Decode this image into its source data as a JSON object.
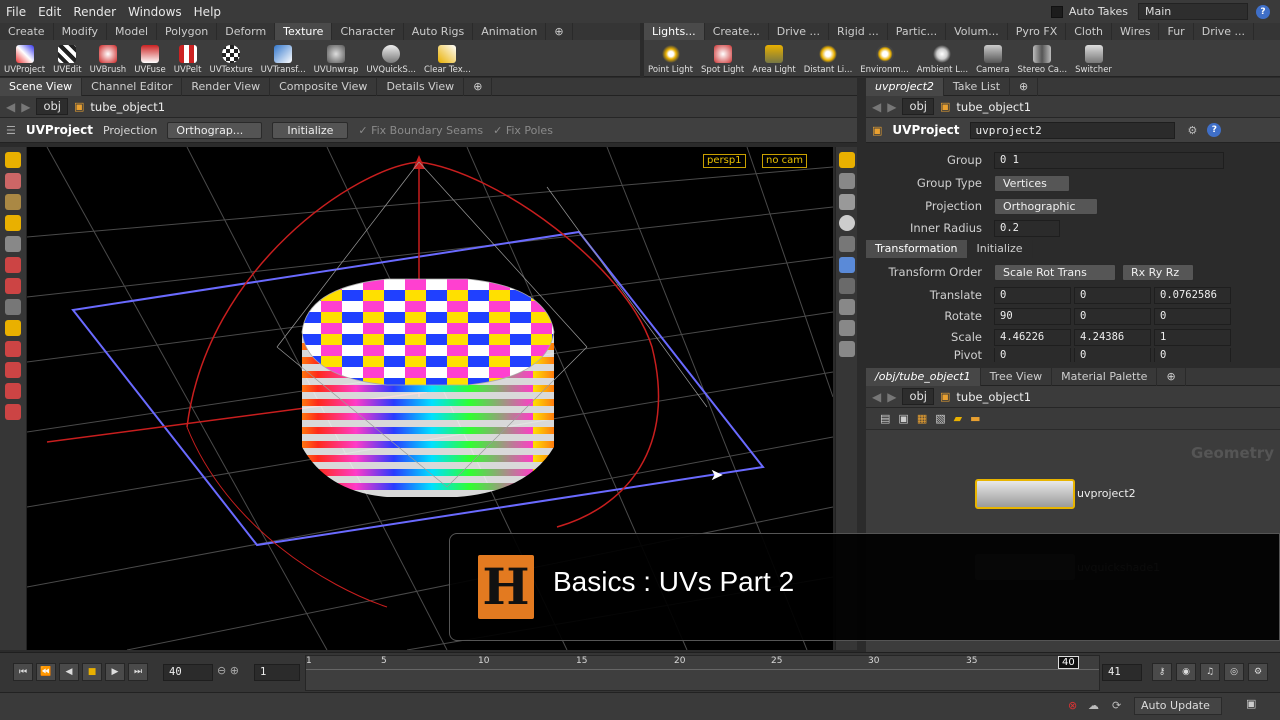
{
  "menubar": {
    "items": [
      "File",
      "Edit",
      "Render",
      "Windows",
      "Help"
    ],
    "auto_takes_label": "Auto Takes",
    "desktop_value": "Main"
  },
  "shelf_left": {
    "tabs": [
      "Create",
      "Modify",
      "Model",
      "Polygon",
      "Deform",
      "Texture",
      "Character",
      "Auto Rigs",
      "Animation"
    ],
    "active_tab": "Texture",
    "tools": [
      "UVProject",
      "UVEdit",
      "UVBrush",
      "UVFuse",
      "UVPelt",
      "UVTexture",
      "UVTransf...",
      "UVUnwrap",
      "UVQuickS...",
      "Clear Tex..."
    ]
  },
  "shelf_right": {
    "tabs": [
      "Lights...",
      "Create...",
      "Drive ...",
      "Rigid ...",
      "Partic...",
      "Volum...",
      "Pyro FX",
      "Cloth",
      "Wires",
      "Fur",
      "Drive ..."
    ],
    "active_tab": "Lights...",
    "tools": [
      "Point Light",
      "Spot Light",
      "Area Light",
      "Distant Li...",
      "Environm...",
      "Ambient L...",
      "Camera",
      "Stereo Ca...",
      "Switcher"
    ]
  },
  "viewer": {
    "tabs": [
      "Scene View",
      "Channel Editor",
      "Render View",
      "Composite View",
      "Details View"
    ],
    "active_tab": "Scene View",
    "path_root": "obj",
    "path_node": "tube_object1",
    "tool_title": "UVProject",
    "projection_label": "Projection",
    "projection_value": "Orthograp...",
    "initialize_label": "Initialize",
    "fix_seams_label": "Fix Boundary Seams",
    "fix_poles_label": "Fix Poles",
    "camera_label": "persp1",
    "cam_label": "no cam"
  },
  "params_panel": {
    "tabs": [
      "uvproject2",
      "Take List"
    ],
    "path_root": "obj",
    "path_node": "tube_object1",
    "node_type": "UVProject",
    "node_name": "uvproject2",
    "group_label": "Group",
    "group_value": "0 1",
    "group_type_label": "Group Type",
    "group_type_value": "Vertices",
    "projection_label": "Projection",
    "projection_value": "Orthographic",
    "inner_radius_label": "Inner Radius",
    "inner_radius_value": "0.2",
    "section_tabs": [
      "Transformation",
      "Initialize"
    ],
    "transform_order_label": "Transform Order",
    "transform_order_value": "Scale Rot Trans",
    "rot_order_value": "Rx Ry Rz",
    "translate_label": "Translate",
    "translate": [
      "0",
      "0",
      "0.0762586"
    ],
    "rotate_label": "Rotate",
    "rotate": [
      "90",
      "0",
      "0"
    ],
    "scale_label": "Scale",
    "scale": [
      "4.46226",
      "4.24386",
      "1"
    ],
    "pivot_label": "Pivot",
    "pivot": [
      "0",
      "0",
      "0"
    ]
  },
  "network": {
    "tabs": [
      "/obj/tube_object1",
      "Tree View",
      "Material Palette"
    ],
    "path_root": "obj",
    "path_node": "tube_object1",
    "context_label": "Geometry",
    "node1_label": "uvproject2",
    "node2_label": "uvquickshade1"
  },
  "overlay": {
    "logo": "H",
    "title": "Basics : UVs Part 2"
  },
  "timeline": {
    "current_frame": "40",
    "start_frame": "1",
    "end_frame": "41",
    "ticks": [
      "1",
      "5",
      "10",
      "15",
      "20",
      "25",
      "30",
      "35"
    ],
    "marker": "40",
    "playhead_fraction": 0.975
  },
  "status": {
    "auto_update": "Auto Update"
  },
  "colors": {
    "accent_blue": "#3f6fc8",
    "node_selected": "#e8b400",
    "axis_red": "#c81e1e",
    "overlay_logo": "#e37a20"
  }
}
